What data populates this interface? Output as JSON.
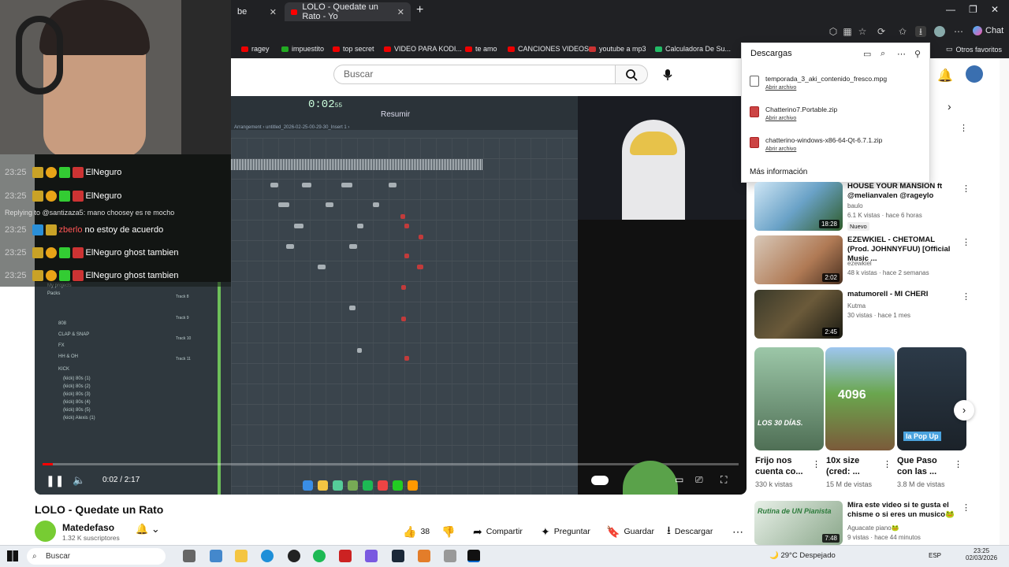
{
  "browser": {
    "tabs": [
      {
        "label": "be"
      },
      {
        "label": "LOLO - Quedate un Rato - Yo"
      }
    ],
    "chat_label": "Chat",
    "bookmarks": [
      "ragey",
      "impuestito",
      "top secret",
      "VIDEO PARA KODI...",
      "te amo",
      "CANCIONES VIDEOS",
      "youtube a mp3",
      "Calculadora De Su..."
    ],
    "other_favorites": "Otros favoritos"
  },
  "downloads": {
    "title": "Descargas",
    "items": [
      {
        "name": "temporada_3_aki_contenido_fresco.mpg",
        "action": "Abrir archivo"
      },
      {
        "name": "Chatterino7.Portable.zip",
        "action": "Abrir archivo"
      },
      {
        "name": "chatterino-windows-x86-64-Qt-6.7.1.zip",
        "action": "Abrir archivo"
      }
    ],
    "more": "Más información"
  },
  "youtube": {
    "search_placeholder": "Buscar",
    "video": {
      "title": "LOLO - Quedate un Rato",
      "channel": "Matedefaso",
      "subscribers": "1.32 K suscriptores",
      "likes": "38",
      "share": "Compartir",
      "ask": "Preguntar",
      "save": "Guardar",
      "download": "Descargar",
      "time": "0:02 / 2:17",
      "progress": 0.015
    },
    "sidebar": [
      {
        "title": "HOUSE YOUR MANSION ft @melianvalen @rageylo",
        "channel": "baulo",
        "meta": "6.1 K vistas · hace 6 horas",
        "badge": "Nuevo",
        "duration": "18:28"
      },
      {
        "title": "EZEWKIEL - CHETOMAL (Prod. JOHNNYFUU) [Official Music ...",
        "channel": "ezewkiel",
        "meta": "48 k vistas · hace 2 semanas",
        "duration": "2:02"
      },
      {
        "title": "matumorell - MI CHERI",
        "channel": "Kutma",
        "meta": "30 vistas · hace 1 mes",
        "duration": "2:45"
      }
    ],
    "shorts": [
      {
        "title": "Frijo nos cuenta co...",
        "meta": "330 k vistas",
        "overlay": "LOS 30 DÍAS."
      },
      {
        "title": "10x size (cred: ...",
        "meta": "15 M de vistas",
        "overlay": "4096"
      },
      {
        "title": "Que Paso con las ...",
        "meta": "3.8 M de vistas",
        "overlay": "la Pop Up"
      }
    ],
    "last_item": {
      "title": "Mira este video si te gusta el chisme o si eres un musico🐸",
      "channel": "Aguacate piano🐸",
      "meta": "9 vistas · hace 44 minutos",
      "duration": "7:48",
      "thumb_text": "Rutina de UN Pianista"
    }
  },
  "fl_studio": {
    "time": "0:02",
    "time_sub": "55",
    "resume": "Resumir",
    "arrangement": "Arrangement › untitled_2026-02-25-00-29-30_Insert 1 ›",
    "tracks": [
      "Track 8",
      "Track 9",
      "Track 10",
      "Track 11"
    ],
    "browser": [
      "My projects",
      "Packs",
      "808",
      "CLAP & SNAP",
      "FX",
      "HH & OH",
      "KICK",
      "(kick) 80s (1)",
      "(kick) 80s (2)",
      "(kick) 80s (3)",
      "(kick) 80s (4)",
      "(kick) 80s (5)",
      "(kick) Alexis (1)"
    ]
  },
  "chat": [
    {
      "time": "23:25",
      "user": "ElNeguro",
      "text": ""
    },
    {
      "time": "23:25",
      "user": "ElNeguro",
      "text": ""
    },
    {
      "time": "",
      "user": "",
      "text": "Replying to @santizaza5: mano choosey es re mocho"
    },
    {
      "time": "23:25",
      "user": "zberlo",
      "text": "no estoy de acuerdo"
    },
    {
      "time": "23:25",
      "user": "ElNeguro",
      "text": "ghost tambien"
    },
    {
      "time": "23:25",
      "user": "ElNeguro",
      "text": "ghost tambien"
    }
  ],
  "taskbar": {
    "search": "Buscar",
    "weather": "29°C  Despejado",
    "lang": "ESP",
    "time": "23:25",
    "date": "02/03/2026"
  }
}
